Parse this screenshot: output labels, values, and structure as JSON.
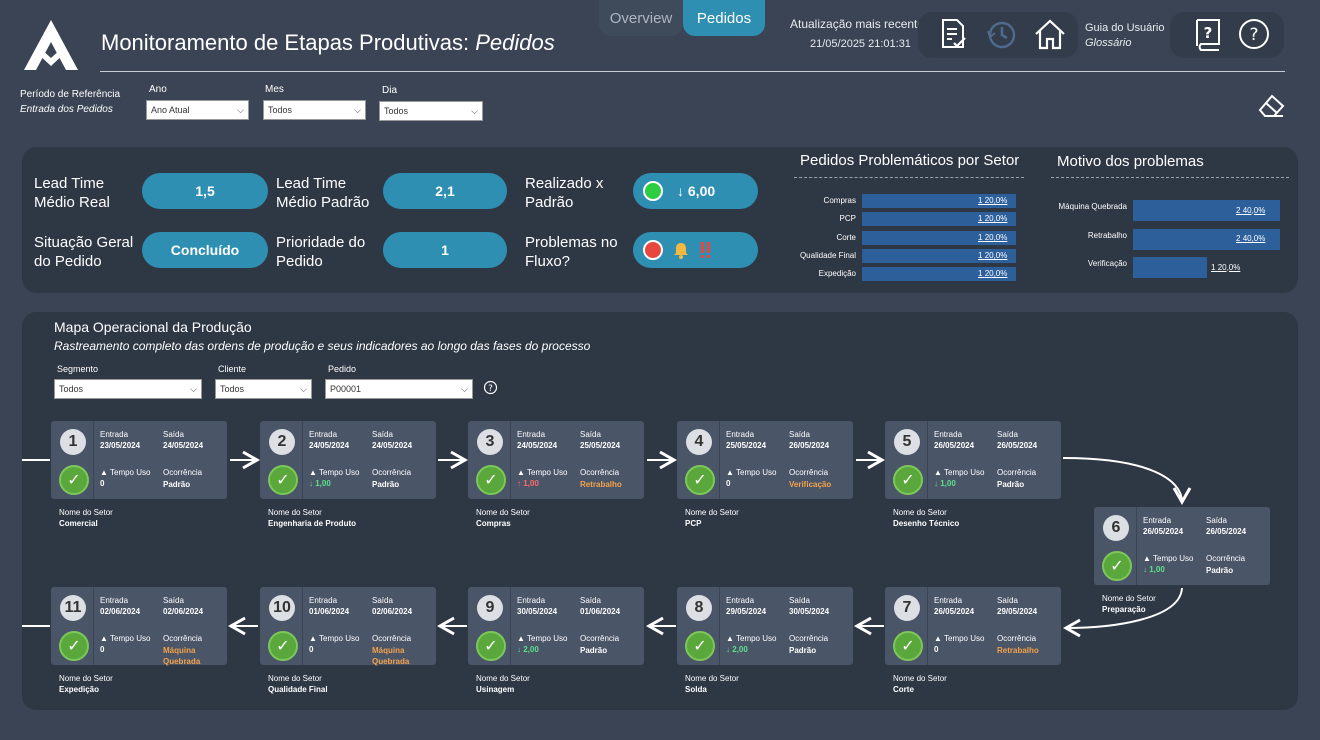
{
  "header": {
    "title_main": "Monitoramento de Etapas Produtivas:",
    "title_em": "Pedidos",
    "tabs": [
      {
        "label": "Overview"
      },
      {
        "label": "Pedidos"
      }
    ],
    "update_label": "Atualização mais recente",
    "update_value": "21/05/2025 21:01:31",
    "guide_label": "Guia do Usuário",
    "glossary_label": "Glossário"
  },
  "filters": {
    "period_label": "Período de Referência",
    "period_sub": "Entrada dos Pedidos",
    "ano": {
      "label": "Ano",
      "value": "Ano Atual"
    },
    "mes": {
      "label": "Mes",
      "value": "Todos"
    },
    "dia": {
      "label": "Dia",
      "value": "Todos"
    }
  },
  "kpis": {
    "lead_real_label": "Lead Time Médio Real",
    "lead_real_value": "1,5",
    "lead_padrao_label": "Lead Time Médio Padrão",
    "lead_padrao_value": "2,1",
    "realizado_label": "Realizado x Padrão",
    "realizado_value": "↓ 6,00",
    "situacao_label": "Situação Geral do Pedido",
    "situacao_value": "Concluído",
    "prioridade_label": "Prioridade do Pedido",
    "prioridade_value": "1",
    "problemas_label": "Problemas no Fluxo?",
    "colors": {
      "green": "#2ecc40",
      "red": "#e8473f",
      "pill": "#2f8fb3"
    }
  },
  "sector_problems": {
    "title": "Pedidos Problemáticos por Setor",
    "rows": [
      {
        "label": "Compras",
        "count": "1",
        "pct": "20,0%",
        "value": 0.2
      },
      {
        "label": "PCP",
        "count": "1",
        "pct": "20,0%",
        "value": 0.2
      },
      {
        "label": "Corte",
        "count": "1",
        "pct": "20,0%",
        "value": 0.2
      },
      {
        "label": "Qualidade Final",
        "count": "1",
        "pct": "20,0%",
        "value": 0.2
      },
      {
        "label": "Expedição",
        "count": "1",
        "pct": "20,0%",
        "value": 0.2
      }
    ]
  },
  "reasons": {
    "title": "Motivo dos problemas",
    "rows": [
      {
        "label": "Máquina Quebrada",
        "count": "2",
        "pct": "40,0%",
        "value": 0.4
      },
      {
        "label": "Retrabalho",
        "count": "2",
        "pct": "40,0%",
        "value": 0.4
      },
      {
        "label": "Verificação",
        "count": "1",
        "pct": "20,0%",
        "value": 0.2
      }
    ]
  },
  "map": {
    "title": "Mapa Operacional da Produção",
    "subtitle": "Rastreamento completo das ordens de produção e seus indicadores ao longo das fases do processo",
    "segmento": {
      "label": "Segmento",
      "value": "Todos"
    },
    "cliente": {
      "label": "Cliente",
      "value": "Todos"
    },
    "pedido": {
      "label": "Pedido",
      "value": "P00001"
    },
    "entrada_label": "Entrada",
    "saida_label": "Saída",
    "tempo_label": "▲ Tempo Uso",
    "ocorr_label": "Ocorrência",
    "sector_label": "Nome do Setor",
    "stages": [
      {
        "n": "1",
        "entrada": "23/05/2024",
        "saida": "24/05/2024",
        "tempo": "0",
        "tempo_style": "b",
        "ocorr": "Padrão",
        "ocorr_style": "b",
        "setor": "Comercial"
      },
      {
        "n": "2",
        "entrada": "24/05/2024",
        "saida": "24/05/2024",
        "tempo": "↓ 1,00",
        "tempo_style": "g",
        "ocorr": "Padrão",
        "ocorr_style": "b",
        "setor": "Engenharia de Produto"
      },
      {
        "n": "3",
        "entrada": "24/05/2024",
        "saida": "25/05/2024",
        "tempo": "↑ 1,00",
        "tempo_style": "r",
        "ocorr": "Retrabalho",
        "ocorr_style": "o",
        "setor": "Compras"
      },
      {
        "n": "4",
        "entrada": "25/05/2024",
        "saida": "26/05/2024",
        "tempo": "0",
        "tempo_style": "b",
        "ocorr": "Verificação",
        "ocorr_style": "o",
        "setor": "PCP"
      },
      {
        "n": "5",
        "entrada": "26/05/2024",
        "saida": "26/05/2024",
        "tempo": "↓ 1,00",
        "tempo_style": "g",
        "ocorr": "Padrão",
        "ocorr_style": "b",
        "setor": "Desenho Técnico"
      },
      {
        "n": "6",
        "entrada": "26/05/2024",
        "saida": "26/05/2024",
        "tempo": "↓ 1,00",
        "tempo_style": "g",
        "ocorr": "Padrão",
        "ocorr_style": "b",
        "setor": "Preparação"
      },
      {
        "n": "7",
        "entrada": "26/05/2024",
        "saida": "29/05/2024",
        "tempo": "0",
        "tempo_style": "b",
        "ocorr": "Retrabalho",
        "ocorr_style": "o",
        "setor": "Corte"
      },
      {
        "n": "8",
        "entrada": "29/05/2024",
        "saida": "30/05/2024",
        "tempo": "↓ 2,00",
        "tempo_style": "g",
        "ocorr": "Padrão",
        "ocorr_style": "b",
        "setor": "Solda"
      },
      {
        "n": "9",
        "entrada": "30/05/2024",
        "saida": "01/06/2024",
        "tempo": "↓ 2,00",
        "tempo_style": "g",
        "ocorr": "Padrão",
        "ocorr_style": "b",
        "setor": "Usinagem"
      },
      {
        "n": "10",
        "entrada": "01/06/2024",
        "saida": "02/06/2024",
        "tempo": "0",
        "tempo_style": "b",
        "ocorr": "Máquina Quebrada",
        "ocorr_style": "o",
        "setor": "Qualidade Final"
      },
      {
        "n": "11",
        "entrada": "02/06/2024",
        "saida": "02/06/2024",
        "tempo": "0",
        "tempo_style": "b",
        "ocorr": "Máquina Quebrada",
        "ocorr_style": "o",
        "setor": "Expedição"
      }
    ]
  }
}
